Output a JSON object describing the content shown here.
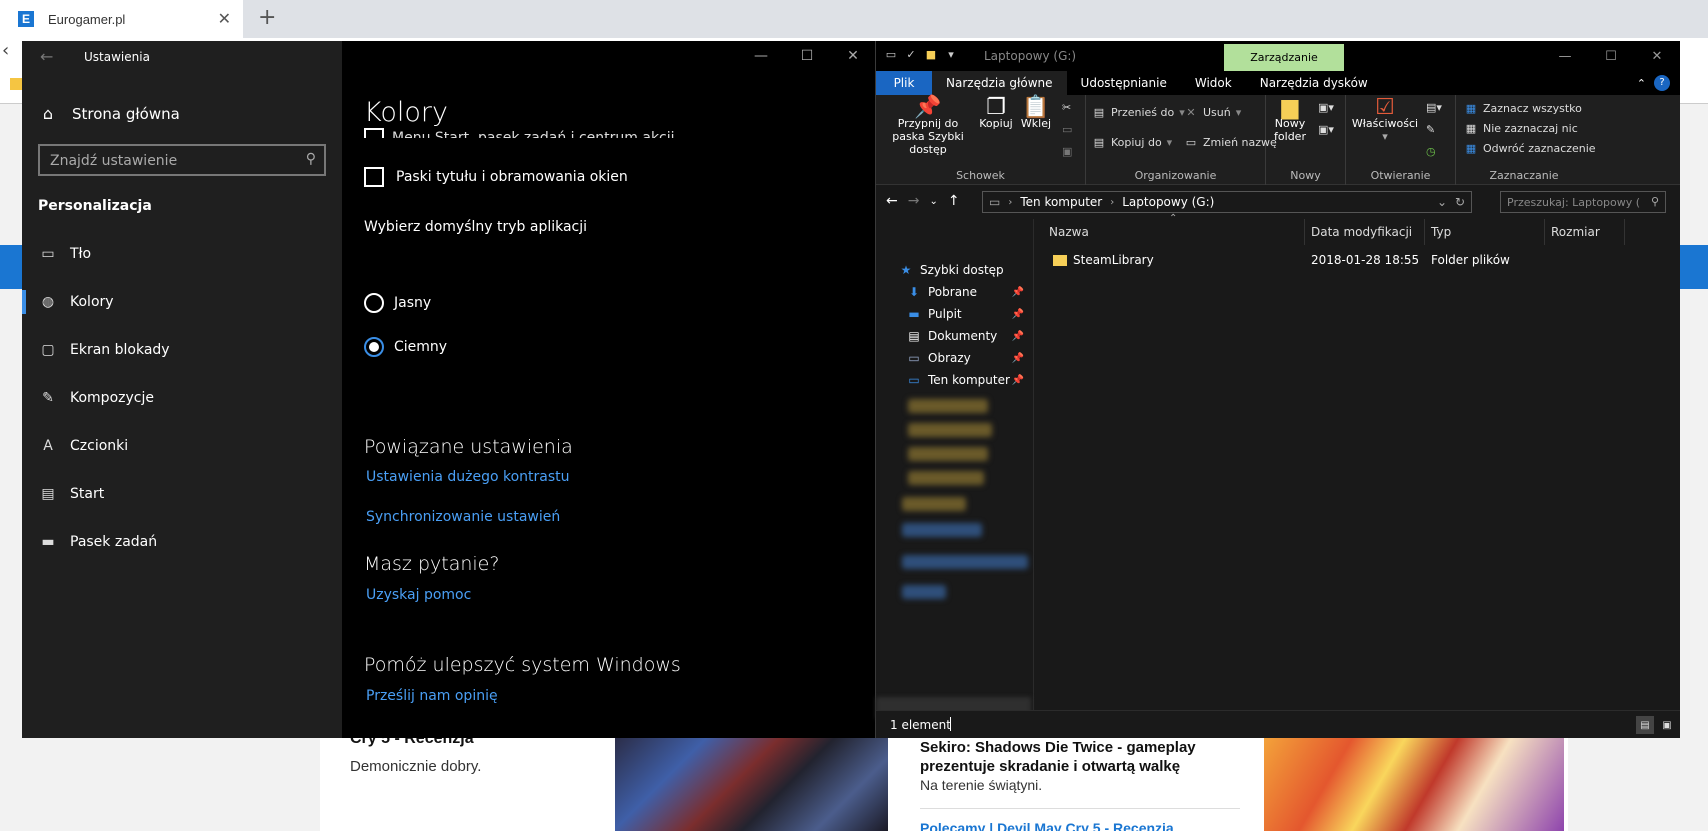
{
  "browser": {
    "tab_favicon": "E",
    "tab_title": "Eurogamer.pl",
    "tab_close": "✕",
    "new_tab": "+",
    "page": {
      "article1_title": "Cry 5 - Recenzja",
      "article1_subtitle": "Demonicznie dobry.",
      "article2_title": "Sekiro: Shadows Die Twice - gameplay prezentuje skradanie i otwartą walkę",
      "article2_subtitle": "Na terenie świątyni.",
      "article3_title": "Polecamy | Devil May Cry 5 - Recenzja",
      "accent_color": "#1a76d2"
    }
  },
  "settings": {
    "app_title": "Ustawienia",
    "home": "Strona główna",
    "search_placeholder": "Znajdź ustawienie",
    "section": "Personalizacja",
    "nav": [
      {
        "label": "Tło",
        "icon": "image-icon"
      },
      {
        "label": "Kolory",
        "icon": "palette-icon",
        "active": true
      },
      {
        "label": "Ekran blokady",
        "icon": "lock-screen-icon"
      },
      {
        "label": "Kompozycje",
        "icon": "themes-icon"
      },
      {
        "label": "Czcionki",
        "icon": "fonts-icon"
      },
      {
        "label": "Start",
        "icon": "start-icon"
      },
      {
        "label": "Pasek zadań",
        "icon": "taskbar-icon"
      }
    ],
    "page_title": "Kolory",
    "cut_option": "Menu Start, pasek zadań i centrum akcji",
    "checkbox_titlebars": "Paski tytułu i obramowania okien",
    "app_mode_label": "Wybierz domyślny tryb aplikacji",
    "mode_light": "Jasny",
    "mode_dark": "Ciemny",
    "mode_selected": "Ciemny",
    "related_heading": "Powiązane ustawienia",
    "link_high_contrast": "Ustawienia dużego kontrastu",
    "link_sync": "Synchronizowanie ustawień",
    "question_heading": "Masz pytanie?",
    "link_help": "Uzyskaj pomoc",
    "improve_heading": "Pomóż ulepszyć system Windows",
    "link_feedback": "Prześlij nam opinię",
    "accent_color": "#3a8ee6"
  },
  "explorer": {
    "window_title": "Laptopowy (G:)",
    "manage_tab": "Zarządzanie",
    "tabs": [
      "Plik",
      "Narzędzia główne",
      "Udostępnianie",
      "Widok",
      "Narzędzia dysków"
    ],
    "ribbon": {
      "pin_label": "Przypnij do paska Szybki dostęp",
      "copy_label": "Kopiuj",
      "paste_label": "Wklej",
      "group_clipboard": "Schowek",
      "move_to": "Przenieś do",
      "copy_to": "Kopiuj do",
      "delete": "Usuń",
      "rename": "Zmień nazwę",
      "group_organize": "Organizowanie",
      "new_folder_line1": "Nowy",
      "new_folder_line2": "folder",
      "group_new": "Nowy",
      "properties": "Właściwości",
      "group_open": "Otwieranie",
      "select_all": "Zaznacz wszystko",
      "select_none": "Nie zaznaczaj nic",
      "invert_selection": "Odwróć zaznaczenie",
      "group_select": "Zaznaczanie"
    },
    "breadcrumb": [
      "Ten komputer",
      "Laptopowy (G:)"
    ],
    "search_placeholder": "Przeszukaj: Laptopowy (...",
    "nav_items": [
      {
        "label": "Szybki dostęp",
        "icon": "star-icon"
      },
      {
        "label": "Pobrane",
        "icon": "download-icon",
        "pinned": true
      },
      {
        "label": "Pulpit",
        "icon": "desktop-icon",
        "pinned": true
      },
      {
        "label": "Dokumenty",
        "icon": "document-icon",
        "pinned": true
      },
      {
        "label": "Obrazy",
        "icon": "pictures-icon",
        "pinned": true
      },
      {
        "label": "Ten komputer",
        "icon": "computer-icon",
        "pinned": true
      }
    ],
    "columns": [
      "Nazwa",
      "Data modyfikacji",
      "Typ",
      "Rozmiar"
    ],
    "files": [
      {
        "name": "SteamLibrary",
        "modified": "2018-01-28 18:55",
        "type": "Folder plików",
        "size": ""
      }
    ],
    "status": "1 element"
  }
}
